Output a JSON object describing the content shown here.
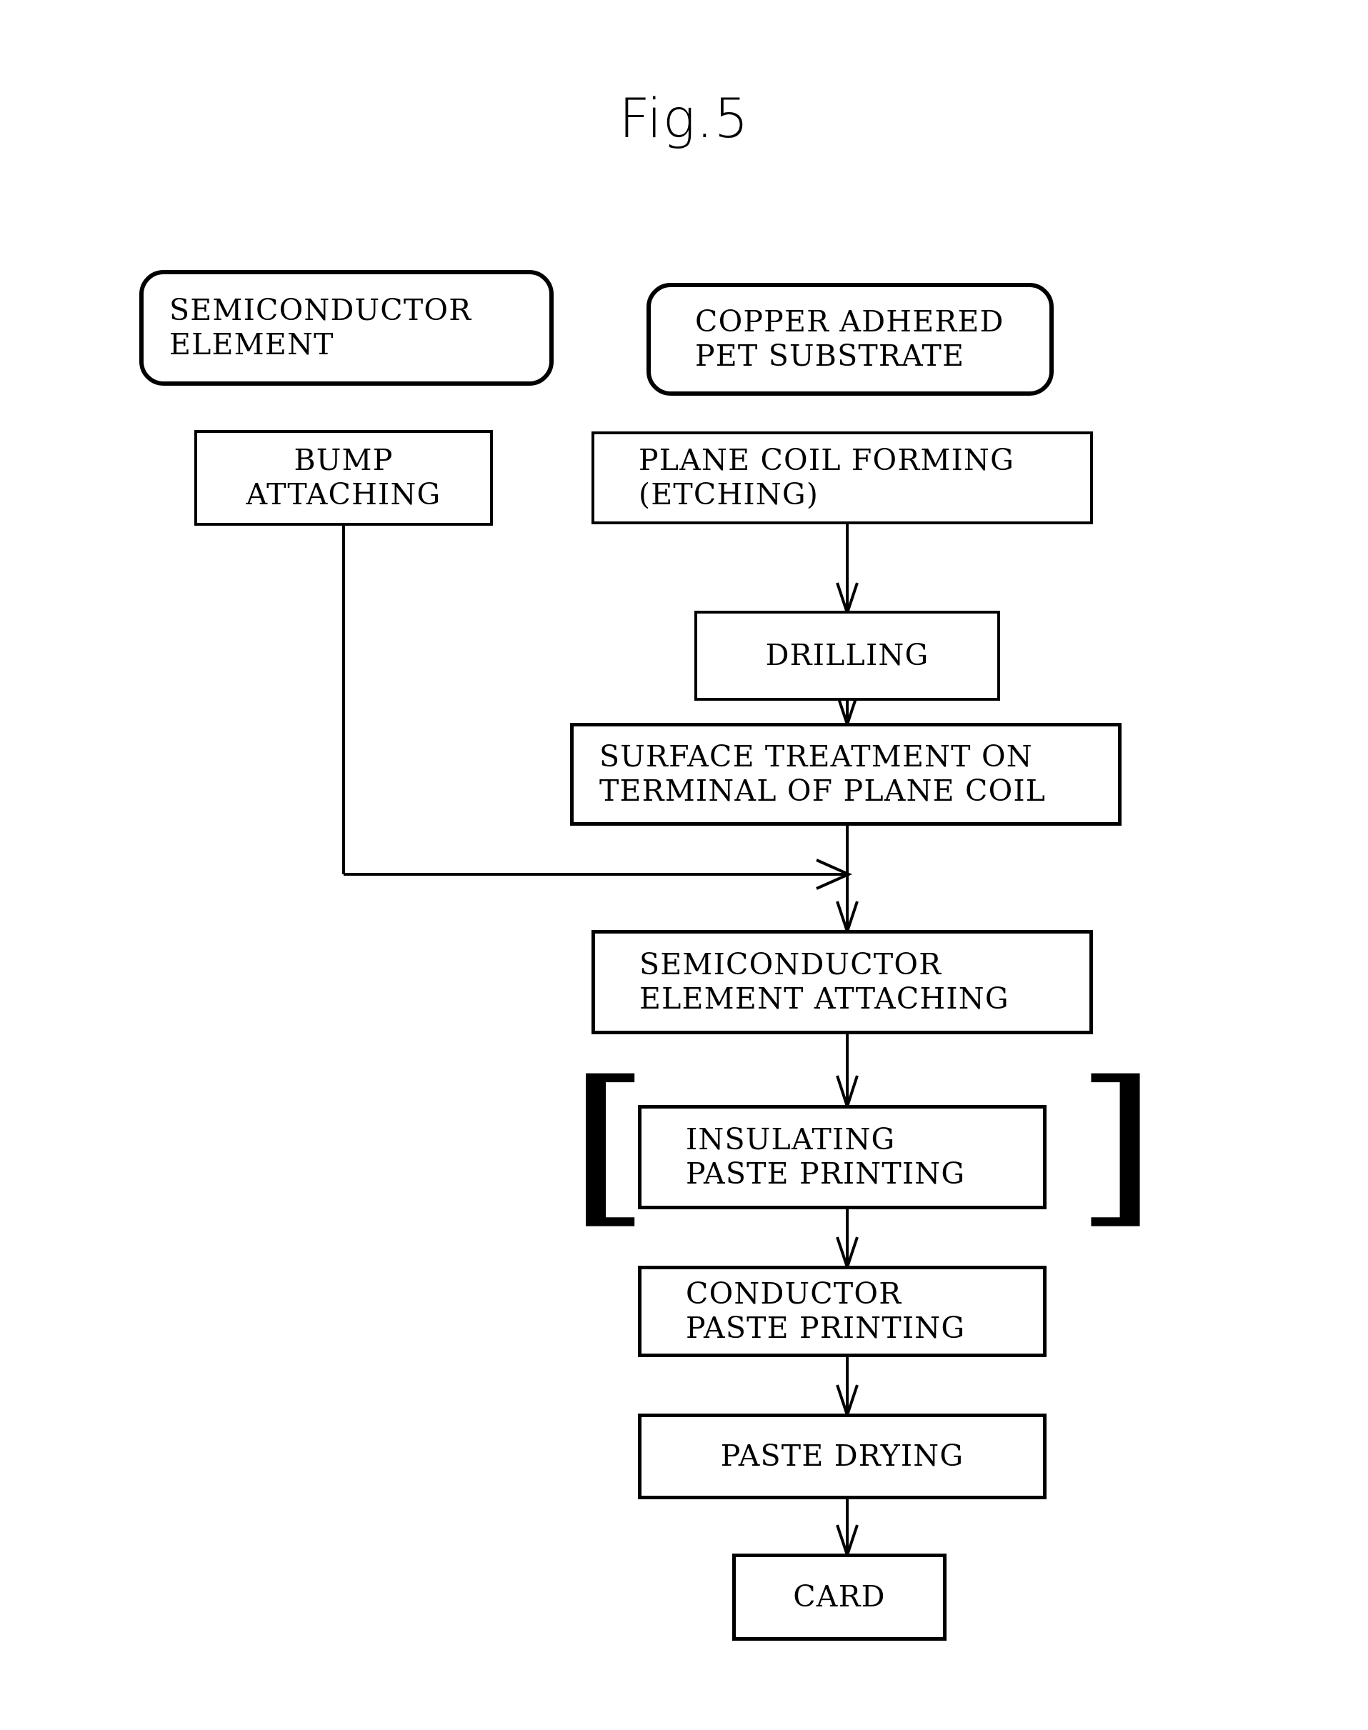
{
  "figure": {
    "title": "Fig.5",
    "type": "process-flow-diagram",
    "description": "Manufacturing process flowchart for an IC card with a plane coil"
  },
  "nodes": {
    "semiconductor_element": {
      "shape": "rounded-rectangle",
      "lines": [
        "SEMICONDUCTOR",
        "ELEMENT"
      ]
    },
    "copper_adhered_pet_substrate": {
      "shape": "rounded-rectangle",
      "lines": [
        "COPPER ADHERED",
        "PET SUBSTRATE"
      ]
    },
    "bump_attaching": {
      "shape": "rectangle",
      "lines": [
        "BUMP",
        "ATTACHING"
      ]
    },
    "plane_coil_forming": {
      "shape": "rectangle",
      "lines": [
        "PLANE COIL FORMING",
        "(ETCHING)"
      ]
    },
    "drilling": {
      "shape": "rectangle",
      "lines": [
        "DRILLING"
      ]
    },
    "surface_treatment": {
      "shape": "rectangle",
      "lines": [
        "SURFACE TREATMENT ON",
        "TERMINAL OF PLANE COIL"
      ]
    },
    "semiconductor_element_attaching": {
      "shape": "rectangle",
      "lines": [
        "SEMICONDUCTOR",
        "ELEMENT ATTACHING"
      ]
    },
    "insulating_paste_printing": {
      "shape": "rectangle-bracketed",
      "lines": [
        "INSULATING",
        "PASTE PRINTING"
      ]
    },
    "conductor_paste_printing": {
      "shape": "rectangle",
      "lines": [
        "CONDUCTOR",
        "PASTE PRINTING"
      ]
    },
    "paste_drying": {
      "shape": "rectangle",
      "lines": [
        "PASTE DRYING"
      ]
    },
    "card": {
      "shape": "rectangle",
      "lines": [
        "CARD"
      ]
    }
  },
  "brackets": {
    "left": "[",
    "right": "]"
  },
  "edges": [
    {
      "from": "copper_adhered_pet_substrate",
      "to": "plane_coil_forming",
      "style": "implicit"
    },
    {
      "from": "plane_coil_forming",
      "to": "drilling",
      "style": "arrow-down"
    },
    {
      "from": "drilling",
      "to": "surface_treatment",
      "style": "arrow-down"
    },
    {
      "from": "surface_treatment",
      "to": "semiconductor_element_attaching",
      "style": "arrow-down"
    },
    {
      "from": "semiconductor_element",
      "to": "bump_attaching",
      "style": "implicit"
    },
    {
      "from": "bump_attaching",
      "to": "semiconductor_element_attaching",
      "style": "elbow-arrow-right"
    },
    {
      "from": "semiconductor_element_attaching",
      "to": "insulating_paste_printing",
      "style": "arrow-down"
    },
    {
      "from": "insulating_paste_printing",
      "to": "conductor_paste_printing",
      "style": "arrow-down"
    },
    {
      "from": "conductor_paste_printing",
      "to": "paste_drying",
      "style": "arrow-down"
    },
    {
      "from": "paste_drying",
      "to": "card",
      "style": "arrow-down"
    }
  ],
  "colors": {
    "ink": "#000000",
    "paper": "#ffffff"
  }
}
